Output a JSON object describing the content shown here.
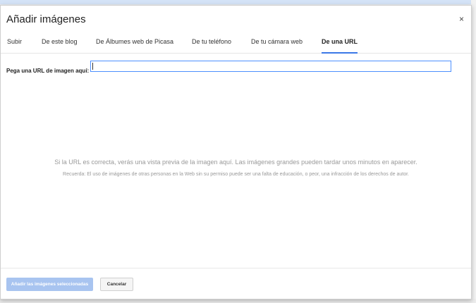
{
  "dialog": {
    "title": "Añadir imágenes",
    "close_label": "×"
  },
  "tabs": [
    {
      "label": "Subir"
    },
    {
      "label": "De este blog"
    },
    {
      "label": "De Álbumes web de Picasa"
    },
    {
      "label": "De tu teléfono"
    },
    {
      "label": "De tu cámara web"
    },
    {
      "label": "De una URL",
      "active": true
    }
  ],
  "url_field": {
    "label": "Pega una URL de imagen aquí:",
    "value": ""
  },
  "preview": {
    "hint": "Si la URL es correcta, verás una vista previa de la imagen aquí. Las imágenes grandes pueden tardar unos minutos en aparecer.",
    "reminder": "Recuerda: El uso de imágenes de otras personas en la Web sin su permiso puede ser una falta de educación, o peor, una infracción de los derechos de autor."
  },
  "buttons": {
    "add_label": "Añadir las imágenes seleccionadas",
    "cancel_label": "Cancelar"
  },
  "colors": {
    "active_tab_underline": "#3b78e7",
    "input_border": "#4d90fe",
    "add_button_disabled": "#a8c4f0"
  }
}
